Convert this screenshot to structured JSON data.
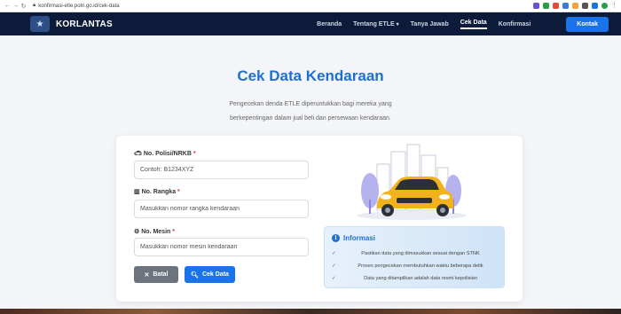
{
  "browser": {
    "url": "konfirmasi-etle.polri.go.id/cek-data"
  },
  "navbar": {
    "brand": "KORLANTAS",
    "links": [
      "Beranda",
      "Tentang ETLE",
      "Tanya Jawab",
      "Cek Data",
      "Konfirmasi"
    ],
    "dropdown_caret": "▾",
    "active_link": "Cek Data",
    "contact_label": "Kontak"
  },
  "hero": {
    "title": "Cek Data Kendaraan",
    "subtitle_line1": "Pengecekan denda ETLE diperuntukkan bagi mereka yang",
    "subtitle_line2": "berkepentingan dalam jual beli dan persewaan kendaraan."
  },
  "form": {
    "plate_label": "No. Polisi/NRKB",
    "plate_placeholder": "Contoh: B1234XYZ",
    "frame_label": "No. Rangka",
    "frame_placeholder": "Masukkan nomor rangka kendaraan",
    "engine_label": "No. Mesin",
    "engine_placeholder": "Masukkan nomor mesin kendaraan",
    "required_mark": "*",
    "cancel_label": "Batal",
    "submit_label": "Cek Data"
  },
  "info": {
    "title": "Informasi",
    "items": [
      "Pastikan data yang dimasukkan sesuai dengan STNK",
      "Proses pengecekan membutuhkan waktu beberapa detik",
      "Data yang ditampilkan adalah data resmi kepolisian"
    ]
  },
  "colors": {
    "navbar": "#0c1b3a",
    "accent": "#1a73e8",
    "title": "#1f6fd1",
    "cancel": "#6c757d"
  }
}
